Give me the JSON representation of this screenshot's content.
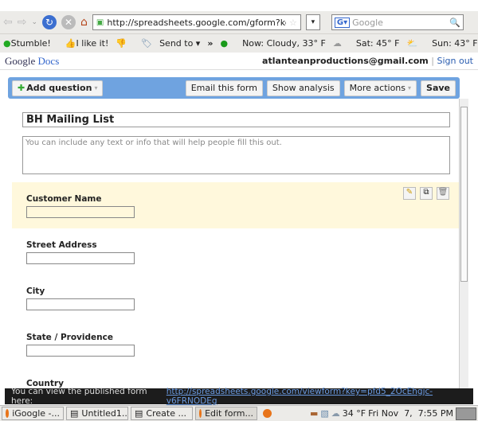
{
  "browser": {
    "url": "http://spreadsheets.google.com/gform?ke",
    "search_placeholder": "Google"
  },
  "bookmarks": {
    "stumble": "Stumble!",
    "like": "I like it!",
    "send_to": "Send to",
    "more": "»",
    "weather_now": "Now: Cloudy, 33° F",
    "weather_sat": "Sat: 45° F",
    "weather_sun": "Sun: 43° F"
  },
  "header": {
    "logo_google": "Google",
    "logo_docs": "Docs",
    "email": "atlanteanproductions@gmail.com",
    "sep": "|",
    "sign_out": "Sign out"
  },
  "toolbar": {
    "add_question": "Add question",
    "email_form": "Email this form",
    "show_analysis": "Show analysis",
    "more_actions": "More actions",
    "save": "Save"
  },
  "form": {
    "title": "BH Mailing List",
    "description_placeholder": "You can include any text or info that will help people fill this out.",
    "questions": [
      {
        "label": "Customer Name"
      },
      {
        "label": "Street Address"
      },
      {
        "label": "City"
      },
      {
        "label": "State / Providence"
      },
      {
        "label": "Country"
      }
    ]
  },
  "status": {
    "text": "You can view the published form here:",
    "link": "http://spreadsheets.google.com/viewform?key=pfd5_2OcEhgjc-v6FRNODEg"
  },
  "taskbar": {
    "tasks": [
      "iGoogle -...",
      "Untitled1...",
      "Create ...",
      "Edit form..."
    ],
    "temp": "34 °F",
    "clock": "Fri Nov  7,  7:55 PM"
  },
  "colors": {
    "toolbar": "#6fa3e0",
    "highlight": "#fff8dc",
    "link": "#2a5db0"
  }
}
